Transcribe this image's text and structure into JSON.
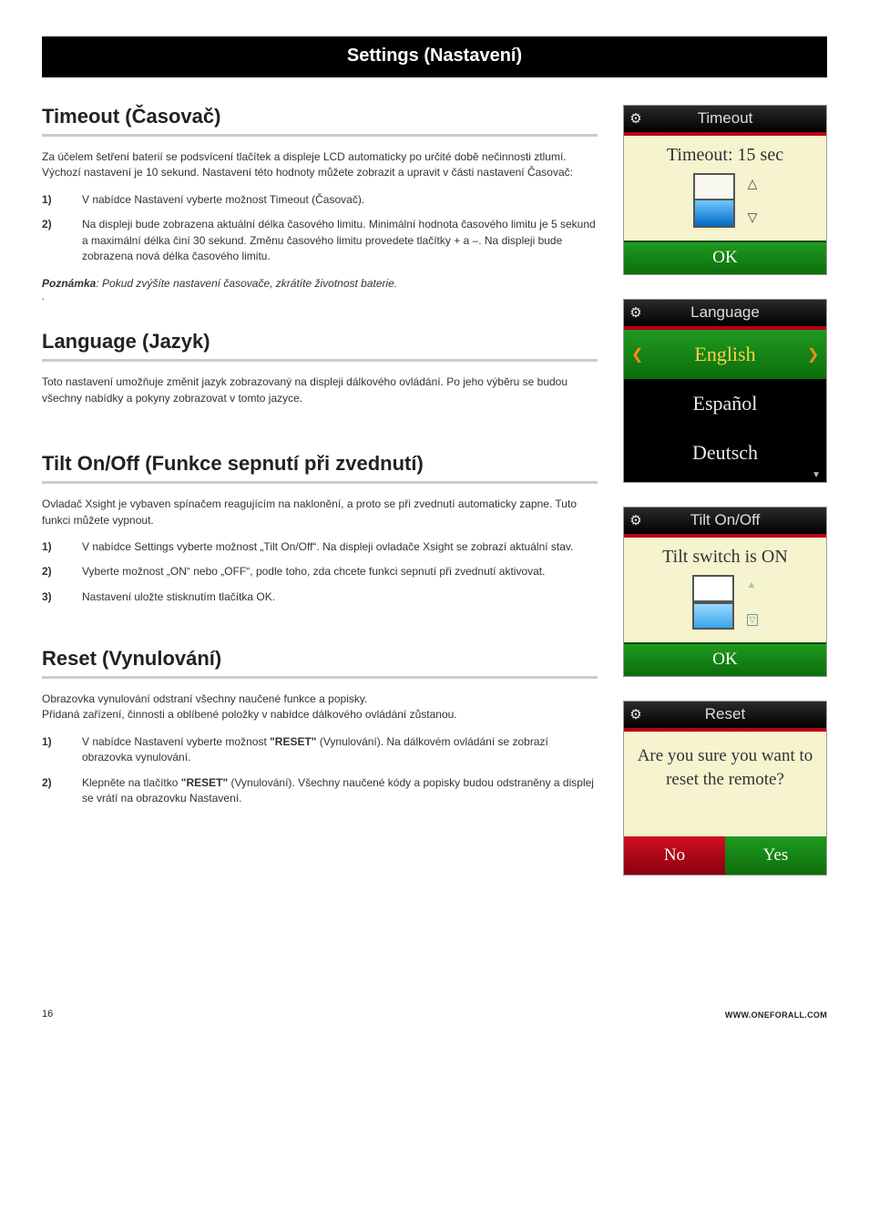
{
  "titleBar": "Settings (Nastavení)",
  "sections": {
    "timeout": {
      "heading": "Timeout (Časovač)",
      "intro": "Za účelem šetření baterií se podsvícení tlačítek a displeje LCD automaticky po určité době nečinnosti ztlumí. Výchozí nastavení je 10 sekund. Nastavení této hodnoty můžete zobrazit a upravit v části nastavení Časovač:",
      "steps": [
        {
          "n": "1)",
          "t": "V nabídce Nastavení vyberte možnost Timeout (Časovač)."
        },
        {
          "n": "2)",
          "t": "Na displeji bude zobrazena aktuální délka časového limitu. Minimální hodnota časového limitu je 5 sekund a maximální délka činí 30 sekund. Změnu časového limitu provedete tlačítky + a –. Na displeji bude zobrazena nová délka časového limitu."
        }
      ],
      "noteLabel": "Poznámka",
      "noteText": ": Pokud zvýšíte nastavení časovače, zkrátíte životnost baterie."
    },
    "language": {
      "heading": "Language (Jazyk)",
      "intro": "Toto nastavení umožňuje změnit jazyk zobrazovaný na displeji dálkového ovládání. Po jeho výběru se budou všechny nabídky a pokyny zobrazovat v tomto jazyce."
    },
    "tilt": {
      "heading": "Tilt On/Off (Funkce sepnutí při zvednutí)",
      "intro": "Ovladač Xsight je vybaven spínačem reagujícím na naklonění, a proto se při zvednutí automaticky zapne. Tuto funkci můžete vypnout.",
      "steps": [
        {
          "n": "1)",
          "t": "V nabídce Settings vyberte možnost „Tilt On/Off“. Na displeji ovladače Xsight se zobrazí aktuální stav."
        },
        {
          "n": "2)",
          "t": "Vyberte možnost „ON“ nebo „OFF“, podle toho, zda chcete funkci sepnutí při zvednutí aktivovat."
        },
        {
          "n": "3)",
          "t": "Nastavení uložte stisknutím tlačítka OK."
        }
      ]
    },
    "reset": {
      "heading": "Reset (Vynulování)",
      "intro1": "Obrazovka vynulování odstraní všechny naučené funkce a popisky.",
      "intro2": "Přidaná zařízení, činnosti a oblíbené položky v nabídce dálkového ovládání zůstanou.",
      "steps": [
        {
          "n": "1)",
          "t1": "V nabídce Nastavení vyberte možnost ",
          "bold": "\"RESET\"",
          "t2": " (Vynulování). Na dálkovém ovládání se zobrazí obrazovka vynulování."
        },
        {
          "n": "2)",
          "t1": "Klepněte na tlačítko ",
          "bold": "\"RESET\"",
          "t2": " (Vynulování). Všechny naučené kódy a popisky budou odstraněny a displej se vrátí na obrazovku Nastavení."
        }
      ]
    }
  },
  "screens": {
    "timeout": {
      "title": "Timeout",
      "value": "Timeout: 15 sec",
      "ok": "OK"
    },
    "language": {
      "title": "Language",
      "items": [
        "English",
        "Español",
        "Deutsch"
      ],
      "selectedIndex": 0
    },
    "tilt": {
      "title": "Tilt On/Off",
      "value": "Tilt switch is ON",
      "ok": "OK"
    },
    "reset": {
      "title": "Reset",
      "question": "Are you sure you want to reset the remote?",
      "no": "No",
      "yes": "Yes"
    }
  },
  "footer": {
    "page": "16",
    "url": "WWW.ONEFORALL.COM"
  }
}
